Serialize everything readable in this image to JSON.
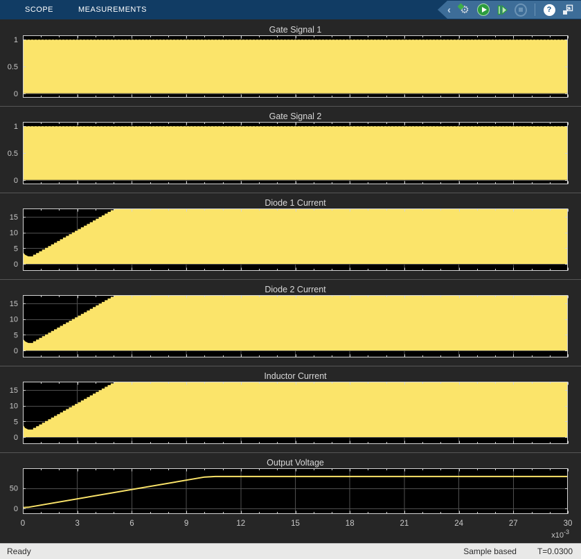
{
  "window": {
    "tabs": [
      {
        "label": "SCOPE"
      },
      {
        "label": "MEASUREMENTS"
      }
    ]
  },
  "toolbar_icons": [
    {
      "name": "collapse-chevron",
      "glyph": "‹"
    },
    {
      "name": "scope-settings",
      "glyph": "⚙"
    },
    {
      "name": "run"
    },
    {
      "name": "step-forward"
    },
    {
      "name": "stop"
    },
    {
      "name": "help",
      "glyph": "?"
    },
    {
      "name": "dock"
    }
  ],
  "status_bar": {
    "left": "Ready",
    "mode": "Sample based",
    "time": "T=0.0300"
  },
  "colors": {
    "signal": "#fbe46a",
    "grid": "#4f4f4f",
    "axis": "#d4d4d4",
    "tick_text": "#c9c9c9",
    "toolbar_bg": "#113c64",
    "icon_strip_bg": "#3d6d98",
    "panel_bg": "#262626",
    "plot_bg": "#000000",
    "status_bg": "#e9e9e8",
    "run_green": "#2c9c3e"
  },
  "chart_data": [
    {
      "type": "area",
      "title": "Gate Signal 1",
      "xlim": [
        0,
        30
      ],
      "xgrid_step": 3,
      "xtick_minor_step": 1,
      "ylim": [
        -0.08,
        1.08
      ],
      "yticks": [
        0,
        0.5,
        1
      ],
      "envelope_top": [
        [
          0,
          1
        ],
        [
          30,
          1
        ]
      ],
      "baseline": 0,
      "pwm_texture": true
    },
    {
      "type": "area",
      "title": "Gate Signal 2",
      "xlim": [
        0,
        30
      ],
      "xgrid_step": 3,
      "xtick_minor_step": 1,
      "ylim": [
        -0.08,
        1.08
      ],
      "yticks": [
        0,
        0.5,
        1
      ],
      "envelope_top": [
        [
          0,
          1
        ],
        [
          30,
          1
        ]
      ],
      "baseline": 0,
      "pwm_texture": true
    },
    {
      "type": "area",
      "title": "Diode 1 Current",
      "xlim": [
        0,
        30
      ],
      "xgrid_step": 3,
      "xtick_minor_step": 1,
      "ylim": [
        -2.2,
        17.6
      ],
      "yticks": [
        0,
        5,
        10,
        15
      ],
      "pre_points": [
        [
          0,
          3.8
        ],
        [
          0.12,
          2.9
        ],
        [
          0.3,
          2.4
        ]
      ],
      "staircase": {
        "t0": 0.4,
        "t1": 5.0,
        "v0": 2.4,
        "v1": 17.6,
        "steps": 28
      },
      "post_points": [
        [
          30,
          17.6
        ]
      ],
      "baseline": 0
    },
    {
      "type": "area",
      "title": "Diode 2 Current",
      "xlim": [
        0,
        30
      ],
      "xgrid_step": 3,
      "xtick_minor_step": 1,
      "ylim": [
        -2.2,
        17.6
      ],
      "yticks": [
        0,
        5,
        10,
        15
      ],
      "pre_points": [
        [
          0,
          3.8
        ],
        [
          0.12,
          2.9
        ],
        [
          0.3,
          2.4
        ]
      ],
      "staircase": {
        "t0": 0.4,
        "t1": 5.0,
        "v0": 2.4,
        "v1": 17.6,
        "steps": 28
      },
      "post_points": [
        [
          30,
          17.6
        ]
      ],
      "baseline": 0
    },
    {
      "type": "area",
      "title": "Inductor Current",
      "xlim": [
        0,
        30
      ],
      "xgrid_step": 3,
      "xtick_minor_step": 1,
      "ylim": [
        -2.2,
        17.6
      ],
      "yticks": [
        0,
        5,
        10,
        15
      ],
      "pre_points": [
        [
          0,
          4.0
        ],
        [
          0.12,
          2.9
        ],
        [
          0.3,
          2.4
        ]
      ],
      "staircase": {
        "t0": 0.4,
        "t1": 5.0,
        "v0": 2.4,
        "v1": 17.6,
        "steps": 28
      },
      "post_points": [
        [
          30,
          17.6
        ]
      ],
      "baseline": 0
    },
    {
      "type": "line",
      "title": "Output Voltage",
      "xlim": [
        0,
        30
      ],
      "xgrid_step": 3,
      "xtick_minor_step": 1,
      "ylim": [
        -14,
        99
      ],
      "yticks": [
        0,
        50
      ],
      "points": [
        [
          0,
          2
        ],
        [
          0.3,
          2.6
        ],
        [
          10.0,
          77.2
        ],
        [
          10.6,
          78.6
        ],
        [
          30,
          78.6
        ]
      ],
      "xlabel_values": [
        0,
        3,
        6,
        9,
        12,
        15,
        18,
        21,
        24,
        27,
        30
      ],
      "x_multiplier": "x10",
      "x_multiplier_exp": "-3"
    }
  ]
}
